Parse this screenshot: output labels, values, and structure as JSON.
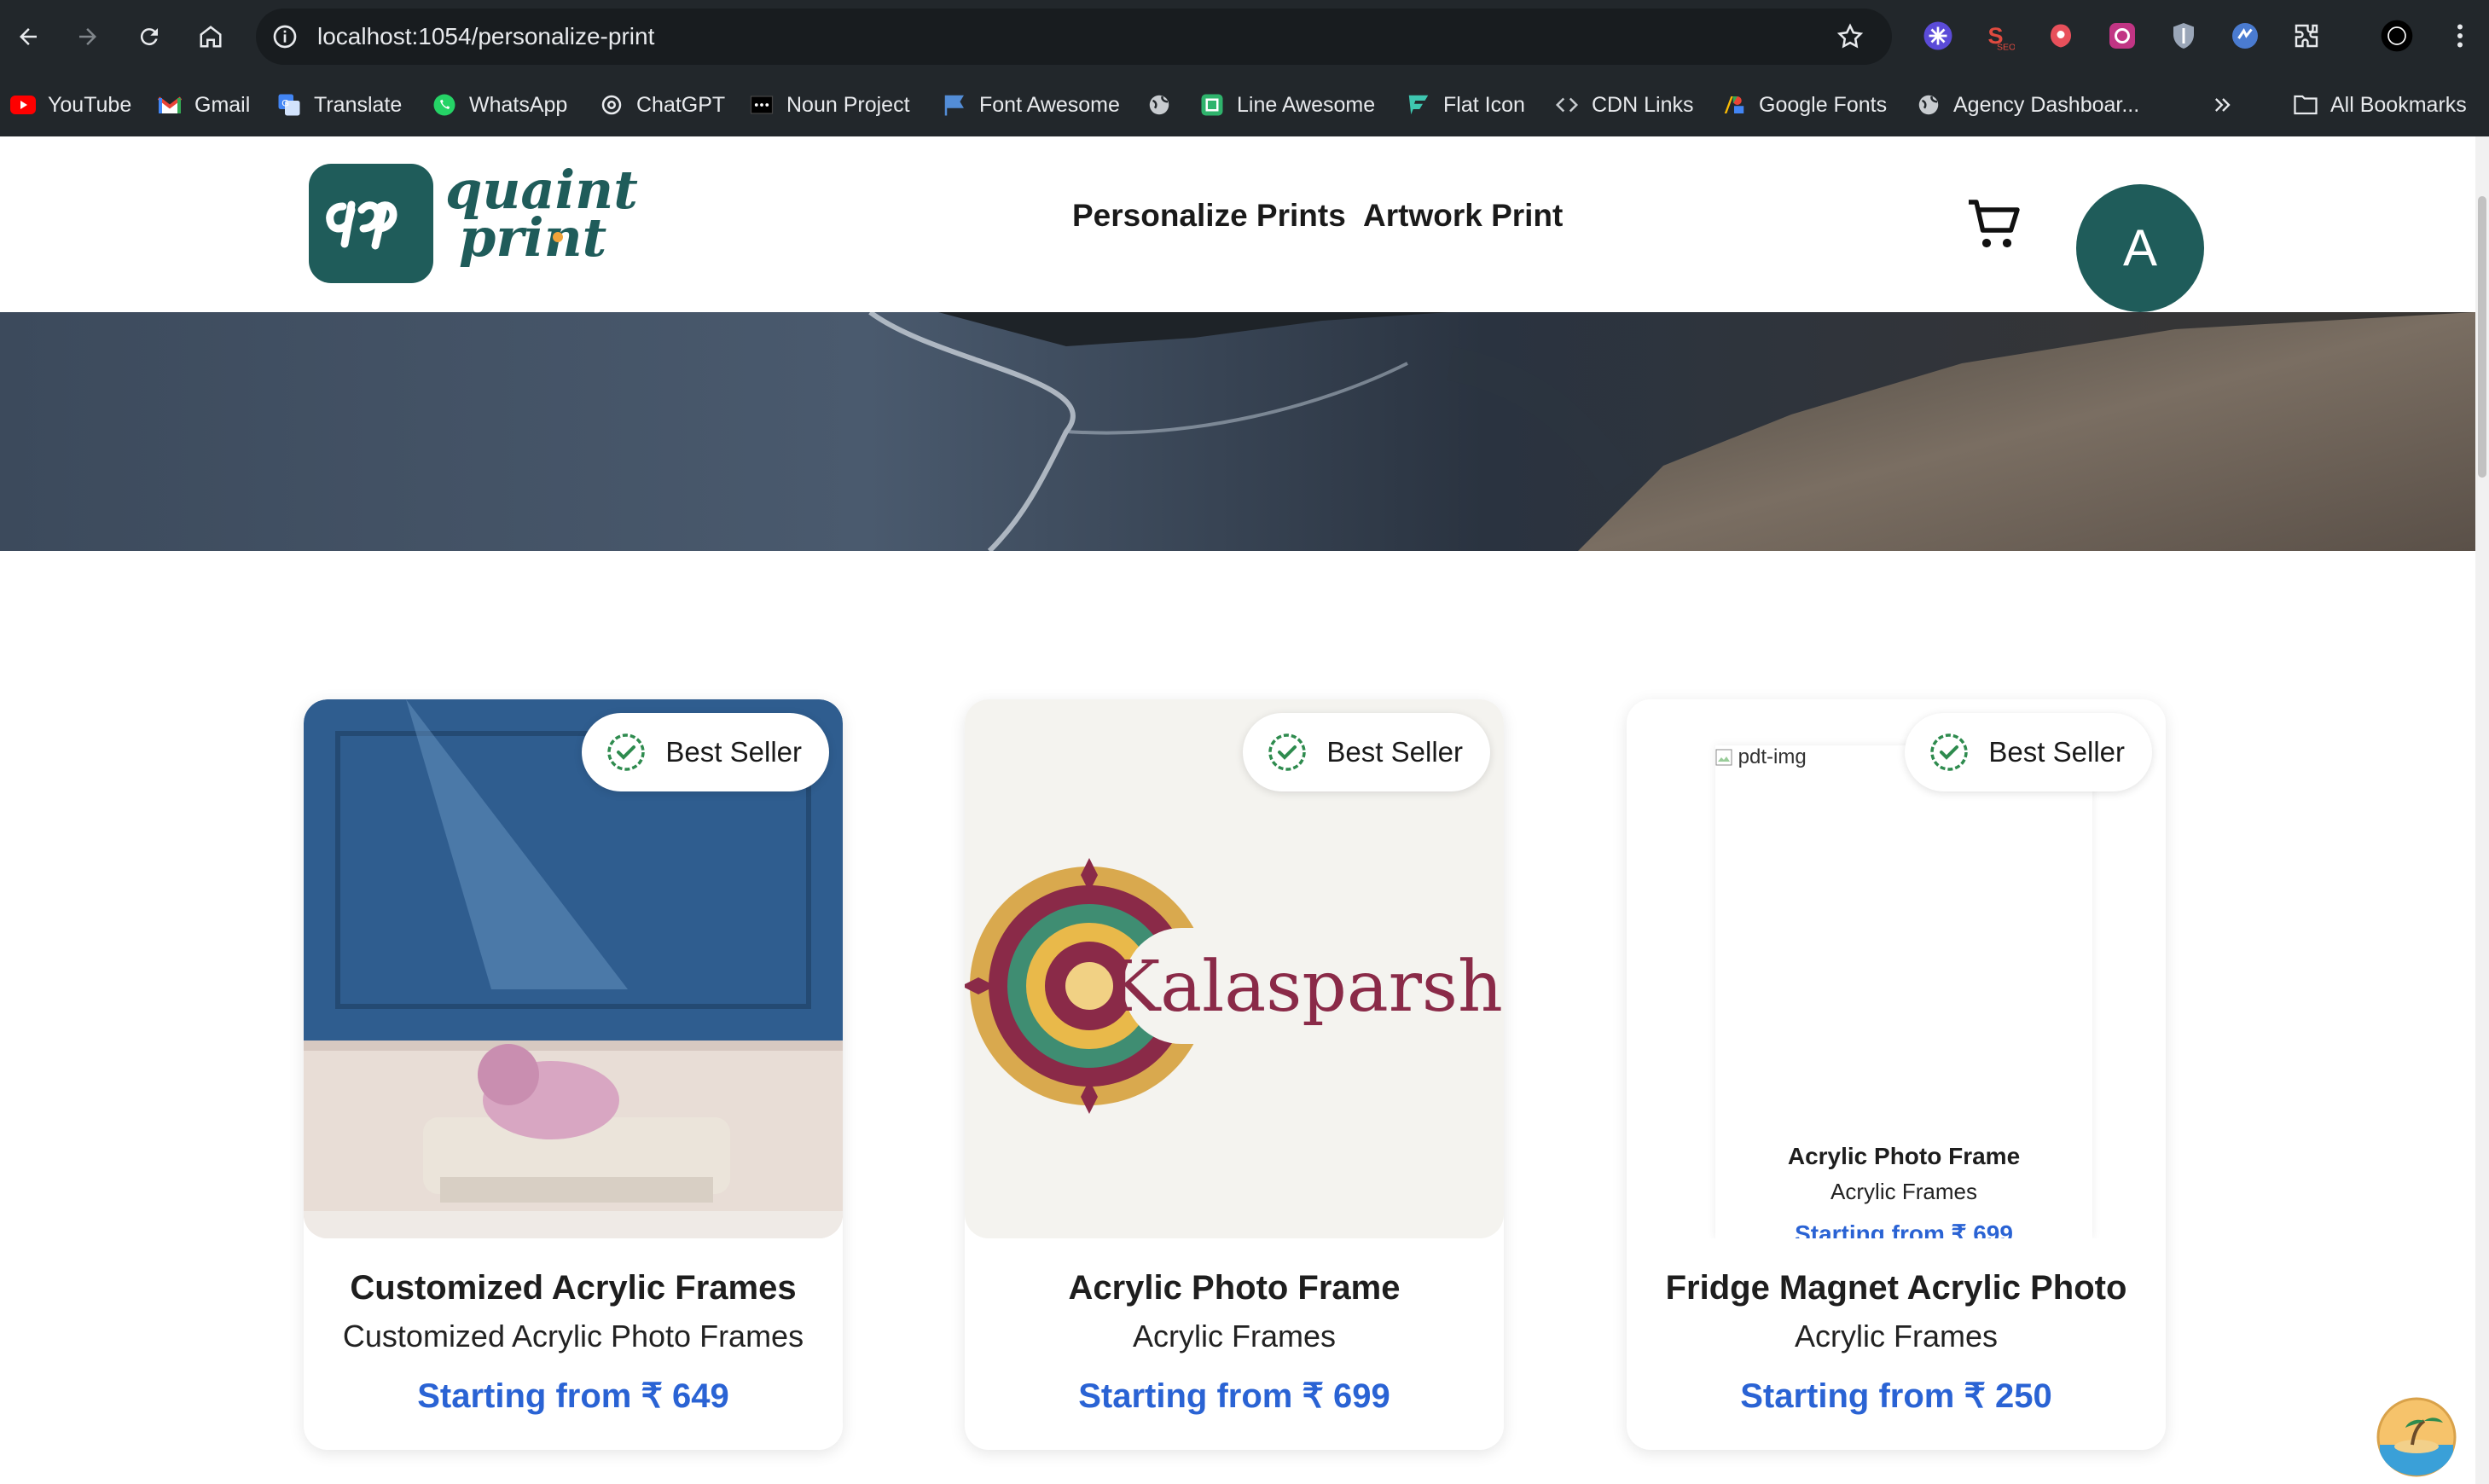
{
  "browser": {
    "url": "localhost:1054/personalize-print",
    "bookmarks": [
      {
        "label": "YouTube",
        "icon": "youtube-icon"
      },
      {
        "label": "Gmail",
        "icon": "gmail-icon"
      },
      {
        "label": "Translate",
        "icon": "translate-icon"
      },
      {
        "label": "WhatsApp",
        "icon": "whatsapp-icon"
      },
      {
        "label": "ChatGPT",
        "icon": "chatgpt-icon"
      },
      {
        "label": "Noun Project",
        "icon": "noun-project-icon"
      },
      {
        "label": "Font Awesome",
        "icon": "font-awesome-icon"
      },
      {
        "label": "",
        "icon": "globe-icon"
      },
      {
        "label": "Line Awesome",
        "icon": "line-awesome-icon"
      },
      {
        "label": "Flat Icon",
        "icon": "flaticon-icon"
      },
      {
        "label": "CDN Links",
        "icon": "code-icon"
      },
      {
        "label": "Google Fonts",
        "icon": "google-fonts-icon"
      },
      {
        "label": "Agency Dashboar...",
        "icon": "globe-icon"
      }
    ],
    "all_bookmarks": "All Bookmarks",
    "extensions": [
      "extension-1-icon",
      "seo-extension-icon",
      "extension-3-icon",
      "extension-4-icon",
      "shield-extension-icon",
      "extension-6-icon",
      "puzzle-icon",
      "profile-icon"
    ]
  },
  "site": {
    "logo_text_1": "quaint",
    "logo_text_2": "print",
    "nav": [
      "Personalize Prints",
      "Artwork Print"
    ],
    "avatar_letter": "A",
    "brand_color": "#1f5c5a",
    "price_color": "#2a63d4"
  },
  "products": [
    {
      "badge": "Best Seller",
      "title": "Customized Acrylic Frames",
      "subtitle": "Customized Acrylic Photo Frames",
      "price": "Starting from ₹ 649"
    },
    {
      "badge": "Best Seller",
      "title": "Acrylic Photo Frame",
      "subtitle": "Acrylic Frames",
      "price": "Starting from ₹ 699",
      "image_text": "Kalasparsh"
    },
    {
      "badge": "Best Seller",
      "title": "Fridge Magnet Acrylic Photo",
      "subtitle": "Acrylic Frames",
      "price": "Starting from ₹ 250",
      "broken_img_alt": "pdt-img",
      "nested": {
        "title": "Acrylic Photo Frame",
        "subtitle": "Acrylic Frames",
        "price": "Starting from ₹ 699"
      }
    }
  ]
}
